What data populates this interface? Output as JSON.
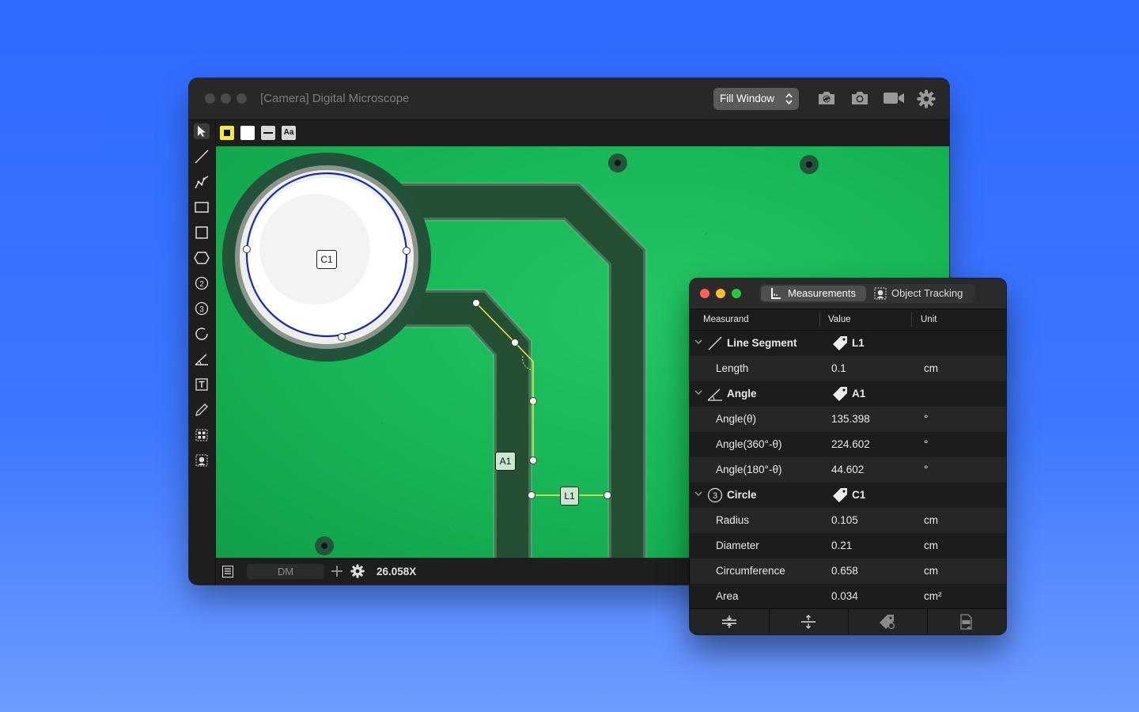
{
  "main_window": {
    "title": "[Camera] Digital Microscope",
    "fit_mode": "Fill Window",
    "toolbar_icons": [
      "camera-switch-icon",
      "camera-icon",
      "video-icon",
      "gear-icon"
    ],
    "options": [
      "stroke-color-yellow",
      "fill-color-white",
      "line-width",
      "font"
    ],
    "options_font_label": "Aa",
    "tools": [
      "pointer-icon",
      "line-icon",
      "polyline-icon",
      "rectangle-icon",
      "square-icon",
      "polygon-icon",
      "circle-2-point-icon",
      "circle-3-point-icon",
      "circle-icon",
      "angle-icon",
      "text-icon",
      "pencil-icon",
      "qr-select-icon",
      "object-track-icon"
    ],
    "canvas": {
      "labels": {
        "circle": "C1",
        "angle": "A1",
        "line": "L1"
      }
    },
    "status": {
      "device_field": "DM",
      "zoom": "26.058X"
    }
  },
  "panel": {
    "tabs": [
      {
        "label": "Measurements",
        "icon": "ruler-icon",
        "active": true
      },
      {
        "label": "Object Tracking",
        "icon": "tracking-icon",
        "active": false
      }
    ],
    "columns": [
      "Measurand",
      "Value",
      "Unit"
    ],
    "groups": [
      {
        "name": "Line Segment",
        "id": "L1",
        "icon": "line-icon",
        "rows": [
          {
            "label": "Length",
            "value": "0.1",
            "unit": "cm"
          }
        ]
      },
      {
        "name": "Angle",
        "id": "A1",
        "icon": "angle-icon",
        "rows": [
          {
            "label": "Angle(θ)",
            "value": "135.398",
            "unit": "°"
          },
          {
            "label": "Angle(360°-θ)",
            "value": "224.602",
            "unit": "°"
          },
          {
            "label": "Angle(180°-θ)",
            "value": "44.602",
            "unit": "°"
          }
        ]
      },
      {
        "name": "Circle",
        "id": "C1",
        "icon": "circle-3-icon",
        "icon_text": "3",
        "rows": [
          {
            "label": "Radius",
            "value": "0.105",
            "unit": "cm"
          },
          {
            "label": "Diameter",
            "value": "0.21",
            "unit": "cm"
          },
          {
            "label": "Circumference",
            "value": "0.658",
            "unit": "cm"
          },
          {
            "label": "Area",
            "value": "0.034",
            "unit": "cm²"
          }
        ]
      }
    ],
    "footer_buttons": [
      "collapse-all-icon",
      "expand-all-icon",
      "tag-settings-icon",
      "export-csv-icon"
    ]
  }
}
